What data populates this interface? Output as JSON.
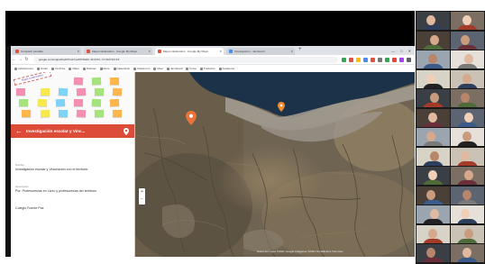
{
  "browser": {
    "tabs": [
      {
        "title": "Compartir pantalla",
        "active": false,
        "favicon": "red"
      },
      {
        "title": "Mapa colaborativo · Google My Maps",
        "active": false,
        "favicon": "red"
      },
      {
        "title": "Mapa colaborativo · Google My Maps",
        "active": true,
        "favicon": "red"
      },
      {
        "title": "Investigación - Jamboard",
        "active": false,
        "favicon": "blue"
      }
    ],
    "new_tab": "+",
    "window_controls": [
      "—",
      "□",
      "✕"
    ],
    "url": "google.com/maps/d/edit?mid=1eZXhN&ll=-33.0472,-71.6127&z=13",
    "bookmarks": [
      "Aplicaciones",
      "Gmail",
      "YouTube",
      "Maps",
      "Noticias",
      "Drive",
      "Calendario",
      "Classroom",
      "Meet",
      "Jamboard",
      "Fotos",
      "Traductor",
      "Academia"
    ],
    "ext_colors": [
      "#34a853",
      "#e0533f",
      "#fbbc05",
      "#4a8af4",
      "#e0533f",
      "#777777",
      "#34a853",
      "#ea4335",
      "#a142f4",
      "#5f6368"
    ]
  },
  "panel": {
    "board_banner": "Mapa colaborativo",
    "sticky_colors": [
      "#f7e84e",
      "#7fd3f7",
      "#f48fb1",
      "#a5e37b",
      "#ffb74d"
    ],
    "header_title": "Investigación escolar y Vinc...",
    "back_icon": "arrow-back-icon",
    "pin_icon": "place-icon",
    "fields": [
      {
        "label": "Nombre",
        "value": "Investigación escolar y Vinculación con el territorio"
      },
      {
        "label": "Descripción",
        "value": "Por: Profesores/as en Liceo y profesores/as del territorio"
      },
      {
        "label": "",
        "value": "Colegio Fuente Paz"
      }
    ]
  },
  "map": {
    "zoom_in": "+",
    "zoom_out": "−",
    "copyright": "Datos del mapa ©2021 Google   Imágenes ©2021 TerraMetrics   Términos"
  },
  "participants": {
    "tile_count": 26
  }
}
